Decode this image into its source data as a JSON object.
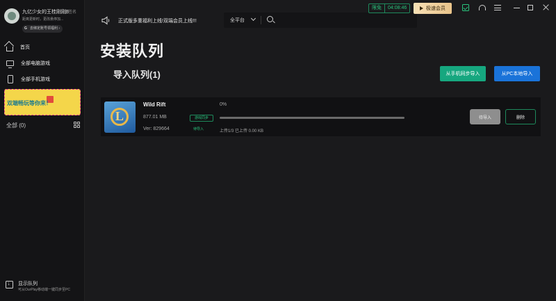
{
  "user": {
    "name": "九亿少女的王桂刚刚8",
    "tag": "已签名",
    "subtitle": "距离更新时，更改悬停加...",
    "bind_label": "去绑定账号领福利 ›"
  },
  "sidebar": {
    "items": [
      {
        "label": "首页",
        "icon": "home-icon"
      },
      {
        "label": "全部电脑游戏",
        "icon": "monitor-icon"
      },
      {
        "label": "全部手机游戏",
        "icon": "phone-icon"
      }
    ],
    "banner_text": "双端畅玩等你来！",
    "all_count": "全部 (0)",
    "footer_title": "显示队列",
    "footer_subtitle": "可从OurPlay移动端一键同步至PC"
  },
  "topbar": {
    "notice": "正式版多重福利上线!双端会员上线!!!",
    "platform": "全平台",
    "search_placeholder": "",
    "free_label": "限免",
    "free_time": "04:08:46",
    "vip_label": "极速会员"
  },
  "main": {
    "title": "安装队列",
    "section_title": "导入队列(1)",
    "btn_phone": "从手机同步导入",
    "btn_pc": "从PC本地导入"
  },
  "queue": [
    {
      "name": "Wild Rift",
      "size": "877.01 MB",
      "version": "Ver: 829664",
      "sync_tag": "游戏同步",
      "status": "待导入",
      "percent_text": "0%",
      "progress": 0,
      "upload_info": "上传1/3 已上传 0.00 KB",
      "btn_wait": "待导入",
      "btn_delete": "删除"
    }
  ],
  "colors": {
    "accent_green": "#2ac47d",
    "button_green": "#16a77f",
    "button_blue": "#1a73d9",
    "background": "#1a1a1c"
  }
}
